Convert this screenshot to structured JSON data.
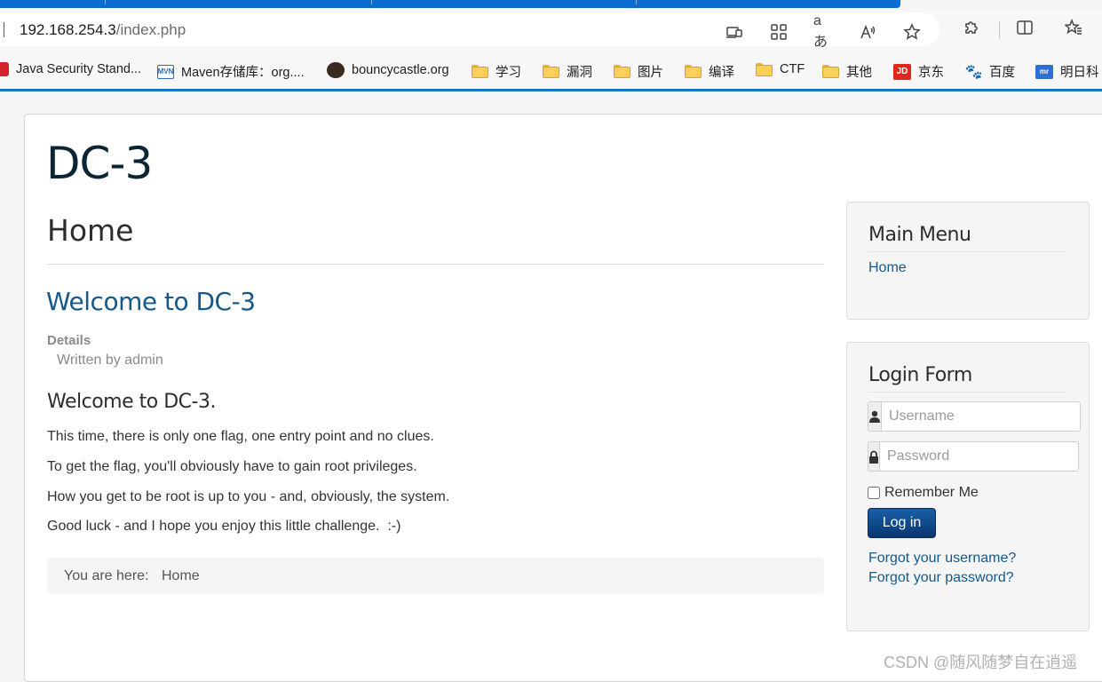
{
  "browser": {
    "url_host": "192.168.254.3",
    "url_path": "/index.php",
    "bookmarks": [
      {
        "label": "Java Security Stand...",
        "icon": "red-site-icon"
      },
      {
        "label": "Maven存储库：org....",
        "icon": "mvn-icon"
      },
      {
        "label": "bouncycastle.org",
        "icon": "bouncycastle-icon"
      },
      {
        "label": "学习",
        "icon": "folder-icon"
      },
      {
        "label": "漏洞",
        "icon": "folder-icon"
      },
      {
        "label": "图片",
        "icon": "folder-icon"
      },
      {
        "label": "编译",
        "icon": "folder-icon"
      },
      {
        "label": "CTF",
        "icon": "folder-icon"
      },
      {
        "label": "其他",
        "icon": "folder-icon"
      },
      {
        "label": "京东",
        "icon": "jd-icon"
      },
      {
        "label": "百度",
        "icon": "baidu-icon"
      },
      {
        "label": "明日科",
        "icon": "mingri-icon"
      }
    ],
    "colors": {
      "accent": "#0a6cd0",
      "bookmark_underline": "#1577c9"
    }
  },
  "site": {
    "title": "DC-3",
    "page_heading": "Home",
    "article": {
      "title": "Welcome to DC-3",
      "details_label": "Details",
      "written_by": "Written by admin",
      "subheading": "Welcome to DC-3.",
      "paragraphs": [
        "This time, there is only one flag, one entry point and no clues.",
        "To get the flag, you'll obviously have to gain root privileges.",
        "How you get to be root is up to you - and, obviously, the system.",
        "Good luck - and I hope you enjoy this little challenge.  :-)"
      ]
    },
    "breadcrumb": {
      "label": "You are here:",
      "item": "Home"
    },
    "colors": {
      "link": "#14598a",
      "title": "#0b2535"
    }
  },
  "sidebar": {
    "main_menu": {
      "title": "Main Menu",
      "items": [
        "Home"
      ]
    },
    "login_form": {
      "title": "Login Form",
      "username_placeholder": "Username",
      "password_placeholder": "Password",
      "remember_label": "Remember Me",
      "login_button": "Log in",
      "forgot_username": "Forgot your username?",
      "forgot_password": "Forgot your password?"
    }
  },
  "watermark": "CSDN @随风随梦自在逍遥"
}
